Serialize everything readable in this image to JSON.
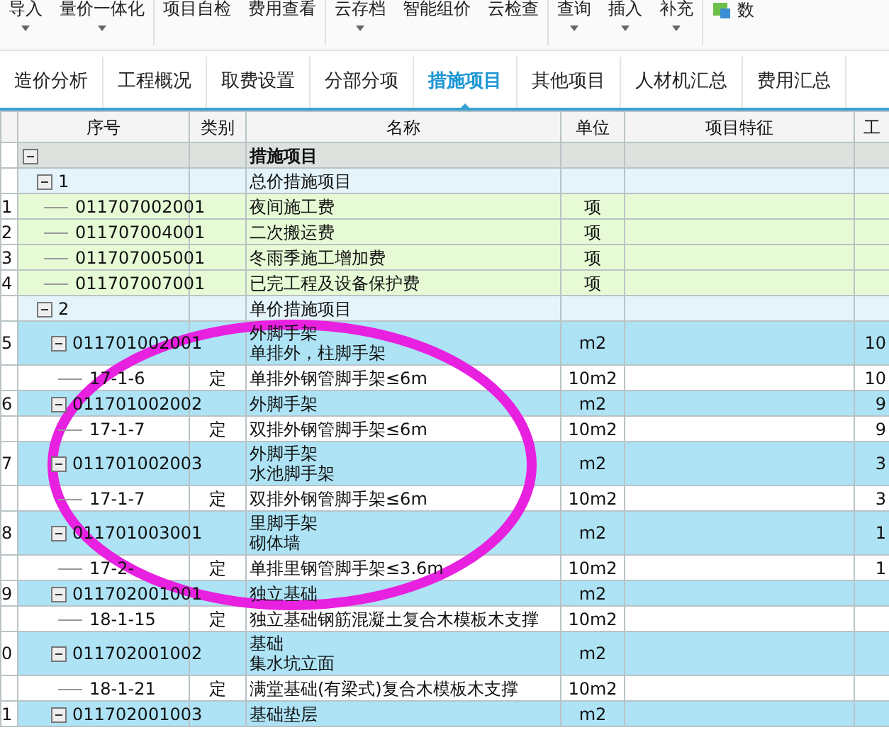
{
  "toolbar": {
    "groups": [
      [
        {
          "label": "导入",
          "dropdown": true
        },
        {
          "label": "量价一体化",
          "dropdown": true
        }
      ],
      [
        {
          "label": "项目自检",
          "dropdown": false
        },
        {
          "label": "费用查看",
          "dropdown": false
        }
      ],
      [
        {
          "label": "云存档",
          "dropdown": true
        },
        {
          "label": "智能组价",
          "dropdown": false
        },
        {
          "label": "云检查",
          "dropdown": false
        }
      ],
      [
        {
          "label": "查询",
          "dropdown": true
        },
        {
          "label": "插入",
          "dropdown": true
        },
        {
          "label": "补充",
          "dropdown": true
        }
      ],
      [
        {
          "label": "数",
          "dropdown": false,
          "icon": true
        }
      ]
    ]
  },
  "tabs": [
    {
      "label": "造价分析",
      "selected": false
    },
    {
      "label": "工程概况",
      "selected": false
    },
    {
      "label": "取费设置",
      "selected": false
    },
    {
      "label": "分部分项",
      "selected": false
    },
    {
      "label": "措施项目",
      "selected": true
    },
    {
      "label": "其他项目",
      "selected": false
    },
    {
      "label": "人材机汇总",
      "selected": false
    },
    {
      "label": "费用汇总",
      "selected": false
    }
  ],
  "table": {
    "columns": [
      "序号",
      "类别",
      "名称",
      "单位",
      "项目特征",
      "工"
    ],
    "rows": [
      {
        "kind": "root",
        "expanded": true,
        "name": [
          "措施项目"
        ],
        "children": [
          {
            "kind": "group",
            "expanded": true,
            "code": "1",
            "name": [
              "总价措施项目"
            ],
            "children": [
              {
                "kind": "item",
                "index": "1",
                "code": "011707002001",
                "name": [
                  "夜间施工费"
                ],
                "unit": "项"
              },
              {
                "kind": "item",
                "index": "2",
                "code": "011707004001",
                "name": [
                  "二次搬运费"
                ],
                "unit": "项"
              },
              {
                "kind": "item",
                "index": "3",
                "code": "011707005001",
                "name": [
                  "冬雨季施工增加费"
                ],
                "unit": "项"
              },
              {
                "kind": "item",
                "index": "4",
                "code": "011707007001",
                "name": [
                  "已完工程及设备保护费"
                ],
                "unit": "项"
              }
            ]
          },
          {
            "kind": "group",
            "expanded": true,
            "code": "2",
            "name": [
              "单价措施项目"
            ],
            "children": [
              {
                "kind": "bill",
                "expanded": true,
                "index": "5",
                "code": "011701002001",
                "name": [
                  "外脚手架",
                  "单排外，柱脚手架"
                ],
                "unit": "m2",
                "column_7": "10",
                "children": [
                  {
                    "kind": "quota",
                    "code": "17-1-6",
                    "category": "定",
                    "name": [
                      "单排外钢管脚手架≤6m"
                    ],
                    "unit": "10m2",
                    "column_7": "10"
                  }
                ]
              },
              {
                "kind": "bill",
                "expanded": true,
                "index": "6",
                "code": "011701002002",
                "name": [
                  "外脚手架"
                ],
                "unit": "m2",
                "column_7": "9",
                "children": [
                  {
                    "kind": "quota",
                    "code": "17-1-7",
                    "category": "定",
                    "name": [
                      "双排外钢管脚手架≤6m"
                    ],
                    "unit": "10m2",
                    "column_7": "9"
                  }
                ]
              },
              {
                "kind": "bill",
                "expanded": true,
                "index": "7",
                "code": "011701002003",
                "name": [
                  "外脚手架",
                  "水池脚手架"
                ],
                "unit": "m2",
                "column_7": "3",
                "children": [
                  {
                    "kind": "quota",
                    "code": "17-1-7",
                    "category": "定",
                    "name": [
                      "双排外钢管脚手架≤6m"
                    ],
                    "unit": "10m2",
                    "column_7": "3"
                  }
                ]
              },
              {
                "kind": "bill",
                "expanded": true,
                "index": "8",
                "code": "011701003001",
                "name": [
                  "里脚手架",
                  "砌体墙"
                ],
                "unit": "m2",
                "column_7": "1",
                "children": [
                  {
                    "kind": "quota",
                    "code": "17-2-",
                    "category": "定",
                    "name": [
                      "单排里钢管脚手架≤3.6m"
                    ],
                    "unit": "10m2",
                    "column_7": "1"
                  }
                ]
              },
              {
                "kind": "bill",
                "expanded": true,
                "index": "9",
                "code": "011702001001",
                "name": [
                  "独立基础"
                ],
                "unit": "m2",
                "children": [
                  {
                    "kind": "quota",
                    "code": "18-1-15",
                    "category": "定",
                    "name": [
                      "独立基础钢筋混凝土复合木模板木支撑"
                    ],
                    "unit": "10m2"
                  }
                ]
              },
              {
                "kind": "bill",
                "expanded": true,
                "index": "0",
                "code": "011702001002",
                "name": [
                  "基础",
                  "集水坑立面"
                ],
                "unit": "m2",
                "children": [
                  {
                    "kind": "quota",
                    "code": "18-1-21",
                    "category": "定",
                    "name": [
                      "满堂基础(有梁式)复合木模板木支撑"
                    ],
                    "unit": "10m2"
                  }
                ]
              },
              {
                "kind": "bill",
                "expanded": true,
                "index": "1",
                "code": "011702001003",
                "name": [
                  "基础垫层"
                ],
                "unit": "m2"
              }
            ]
          }
        ]
      }
    ]
  },
  "annotation": {
    "kind": "ellipse",
    "color": "#e820e0"
  }
}
